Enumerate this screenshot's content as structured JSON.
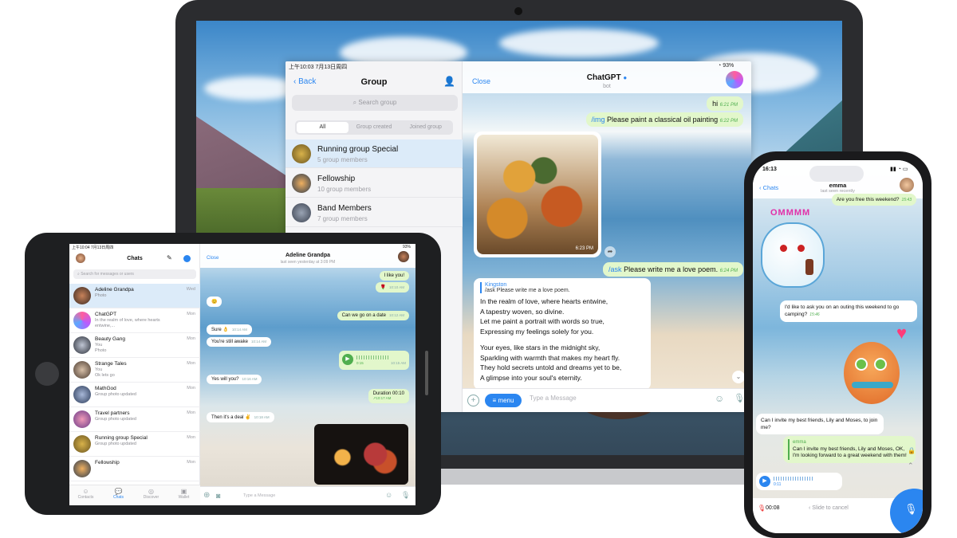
{
  "laptop": {
    "status_time": "上午10:03  7月13日周四",
    "status_battery": "93%",
    "group_panel": {
      "back_label": "Back",
      "title": "Group",
      "search_placeholder": "Search group",
      "segments": [
        "All",
        "Group created",
        "Joined group"
      ],
      "groups": [
        {
          "name": "Running group Special",
          "members": "5 group members"
        },
        {
          "name": "Fellowship",
          "members": "10 group members"
        },
        {
          "name": "Band Members",
          "members": "7 group members"
        }
      ]
    },
    "chat": {
      "close_label": "Close",
      "title": "ChatGPT",
      "subtitle": "bot",
      "msg_hi": "hi",
      "msg_hi_time": "6:21 PM",
      "msg_img_cmd": "/img",
      "msg_img_text": " Please paint a classical oil painting",
      "msg_img_time": "6:22 PM",
      "image_time": "6:23 PM",
      "msg_ask_cmd": "/ask",
      "msg_ask_text": " Please write me a love poem.",
      "msg_ask_time": "6:24 PM",
      "reply_quote_name": "Kingston",
      "reply_quote_text": "/ask Please write me a love poem.",
      "poem_lines": [
        "In the realm of love, where hearts entwine,",
        "A tapestry woven, so divine.",
        "Let me paint a portrait with words so true,",
        "Expressing my feelings solely for you.",
        "",
        "Your eyes, like stars in the midnight sky,",
        "Sparkling with warmth that makes my heart fly.",
        "They hold secrets untold and dreams yet to be,",
        "A glimpse into your soul's eternity."
      ],
      "menu_label": "menu",
      "input_placeholder": "Type a Message"
    }
  },
  "tablet": {
    "status_time": "上午10:04  7月13日周四",
    "status_battery": "93%",
    "chats_title": "Chats",
    "search_placeholder": "Search for messages or users",
    "chats": [
      {
        "name": "Adeline Grandpa",
        "line2": "Photo",
        "line3": "",
        "time": "Wed"
      },
      {
        "name": "ChatGPT",
        "line2": "In the realm of love, where hearts",
        "line3": "entwine,...",
        "time": "Mon"
      },
      {
        "name": "Beauty Gang",
        "line2": "You",
        "line3": "Photo",
        "time": "Mon"
      },
      {
        "name": "Strange Tales",
        "line2": "You",
        "line3": "Ok lets go",
        "time": "Mon"
      },
      {
        "name": "MathGod",
        "line2": "Group photo updated",
        "line3": "",
        "time": "Mon"
      },
      {
        "name": "Travel partners",
        "line2": "Group photo updated",
        "line3": "",
        "time": "Mon"
      },
      {
        "name": "Running group Special",
        "line2": "Group photo updated",
        "line3": "",
        "time": "Mon"
      },
      {
        "name": "Fellowship",
        "line2": "",
        "line3": "",
        "time": "Mon"
      }
    ],
    "tabs": [
      "Contacts",
      "Chats",
      "Discover",
      "Wallet"
    ],
    "chat": {
      "close_label": "Close",
      "title": "Adeline Grandpa",
      "subtitle": "last seen yesterday at 3:09 PM",
      "messages": [
        {
          "text": "I like you!",
          "time": "10:10 AM"
        },
        {
          "text": "Can we go on a date",
          "time": "10:12 AM"
        },
        {
          "text": "Sure 👌",
          "time": "10:14 AM"
        },
        {
          "text": "You're still awake",
          "time": "10:14 AM"
        },
        {
          "text": "Yes will you?",
          "time": "10:16 AM"
        },
        {
          "text": "Then it's a deal ✌",
          "time": "10:18 AM"
        }
      ],
      "voice_duration": "0:15",
      "voice_time": "10:15 AM",
      "call_label": "Duration 00:10",
      "call_time": "10:17 AM",
      "input_placeholder": "Type a Message"
    }
  },
  "phone": {
    "status_time": "16:13",
    "back_label": "Chats",
    "title": "emma",
    "subtitle": "last seen recently",
    "msg1": "Are you free this weekend?",
    "msg1_time": "15:43",
    "sticker_text": "OMMMM",
    "msg2": "I'd like to ask you on an outing this weekend to go camping?",
    "msg2_time": "15:46",
    "msg3": "Can I invite my best friends, Lily and Moses, to join me?",
    "reply_name": "emma",
    "reply_text": "Can I invite my best friends, Lily and Moses, OK, I'm looking forward to a great weekend with them!",
    "voice_duration": "0:11",
    "record_time": "00:08",
    "slide_cancel": "Slide to cancel"
  }
}
